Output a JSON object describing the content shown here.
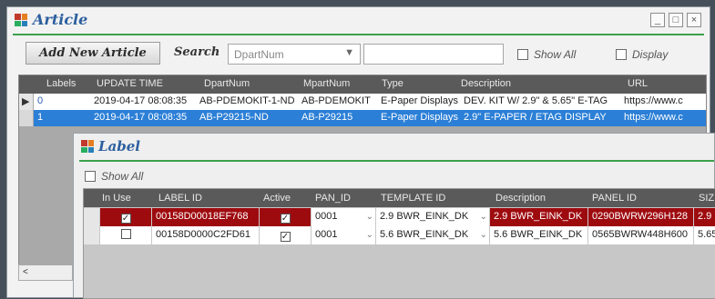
{
  "article": {
    "title": "Article",
    "add_button": "Add New Article",
    "search_label": "Search",
    "search_field": "DpartNum",
    "show_all": "Show All",
    "display": "Display",
    "columns": [
      "Labels",
      "UPDATE TIME",
      "DpartNum",
      "MpartNum",
      "Type",
      "Description",
      "URL"
    ],
    "rows": [
      {
        "labels": "0",
        "update_time": "2019-04-17 08:08:35",
        "dpartnum": "AB-PDEMOKIT-1-ND",
        "mpartnum": "AB-PDEMOKIT",
        "type": "E-Paper Displays",
        "description": "DEV. KIT W/ 2.9\" & 5.65\" E-TAG",
        "url": "https://www.c"
      },
      {
        "labels": "1",
        "update_time": "2019-04-17 08:08:35",
        "dpartnum": "AB-P29215-ND",
        "mpartnum": "AB-P29215",
        "type": "E-Paper Displays",
        "description": "2.9\" E-PAPER / ETAG DISPLAY",
        "url": "https://www.c"
      }
    ],
    "scroll_left": "<"
  },
  "label": {
    "title": "Label",
    "show_all": "Show All",
    "columns": [
      "In Use",
      "LABEL ID",
      "Active",
      "PAN_ID",
      "TEMPLATE ID",
      "Description",
      "PANEL ID",
      "SIZE"
    ],
    "rows": [
      {
        "label_id": "00158D00018EF768",
        "pan_id": "0001",
        "template_id": "2.9 BWR_EINK_DK",
        "description": "2.9 BWR_EINK_DK",
        "panel_id": "0290BWRW296H128",
        "size": "2.9"
      },
      {
        "label_id": "00158D0000C2FD61",
        "pan_id": "0001",
        "template_id": "5.6 BWR_EINK_DK",
        "description": "5.6 BWR_EINK_DK",
        "panel_id": "0565BWRW448H600",
        "size": "5.65"
      }
    ]
  },
  "colors": {
    "title": "#2c5f9e",
    "accent_line": "#3aa14c",
    "selected_row": "#2b7fd6",
    "highlight_row": "#9e0b0f"
  }
}
